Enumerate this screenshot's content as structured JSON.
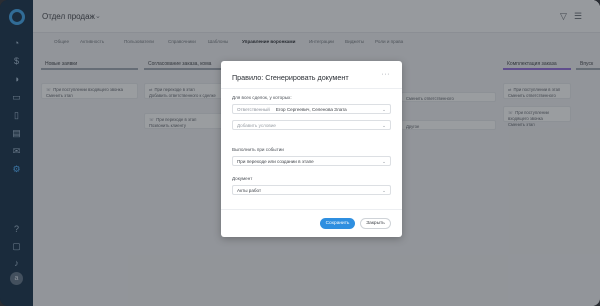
{
  "topbar": {
    "title": "Отдел продаж",
    "caret": "⌄",
    "filter_icon": "filter-icon",
    "list_icon": "list-icon"
  },
  "tabs": [
    {
      "label": "Общее",
      "active": false
    },
    {
      "label": "Активность",
      "active": false
    },
    {
      "label": "Пользователи",
      "active": false
    },
    {
      "label": "Справочники",
      "active": false
    },
    {
      "label": "Шаблоны",
      "active": false
    },
    {
      "label": "Управление воронками",
      "active": true
    },
    {
      "label": "Интеграции",
      "active": false
    },
    {
      "label": "Виджеты",
      "active": false
    },
    {
      "label": "Роли и права",
      "active": false
    }
  ],
  "columns": [
    {
      "title": "Новые заявки",
      "cards": [
        "При поступлении входящего звонка",
        "Сменить этап"
      ]
    },
    {
      "title": "Согласование заказа, кома",
      "cards": [
        "При переходе в этап",
        "Добавить ответственного к сделке",
        "При переходе в этап",
        "Позвонить клиенту"
      ]
    },
    {
      "title": "",
      "cards": [
        "",
        "Сменить ответственного",
        "Другое"
      ]
    },
    {
      "title": "Комплектация заказа",
      "cards": [
        "При поступлении в этап",
        "Сменить ответственного",
        "При поступлении входящего звонка",
        "Сменить этап"
      ]
    },
    {
      "title": "Впуск",
      "cards": []
    }
  ],
  "modal": {
    "title": "Правило: Сгенерировать документ",
    "menu": "···",
    "for_all_label": "Для всех сделок, у которых:",
    "responsible_key": "Ответственный",
    "responsible_value": "Егор Сергеевич, Селенова Злата",
    "add_condition_placeholder": "Добавить условие",
    "trigger_label": "Выполнить при событии",
    "trigger_value": "При переходе или создании в этапе",
    "document_label": "Документ",
    "document_value": "Акты работ",
    "save_label": "Сохранить",
    "close_label": "Закрыть"
  },
  "colors": {
    "accent": "#2f8fe0",
    "rail": "#0f2a44"
  }
}
